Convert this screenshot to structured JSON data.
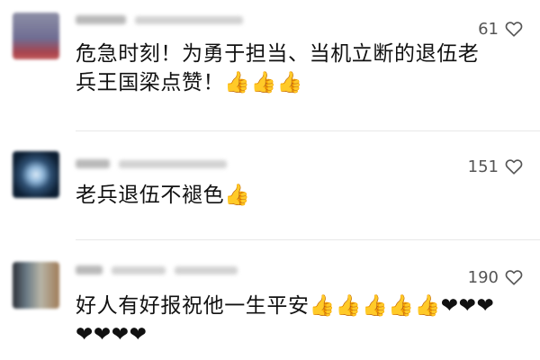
{
  "comments": [
    {
      "text": "危急时刻！为勇于担当、当机立断的退伍老兵王国梁点赞！👍👍👍",
      "likes": "61"
    },
    {
      "text": "老兵退伍不褪色👍",
      "likes": "151"
    },
    {
      "text": "好人有好报祝他一生平安👍👍👍👍👍❤❤❤❤❤❤❤",
      "likes": "190"
    }
  ],
  "colors": {
    "text": "#111111",
    "muted": "#555555",
    "divider": "#e8e8e8"
  },
  "icons": {
    "like": "heart-outline-icon"
  }
}
